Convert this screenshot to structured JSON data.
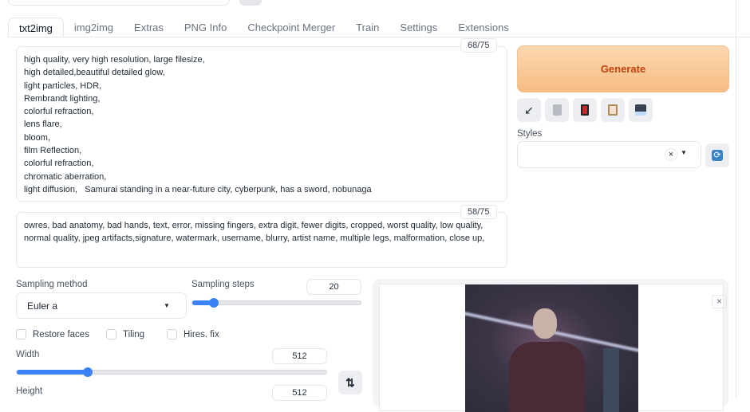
{
  "tabs": [
    "txt2img",
    "img2img",
    "Extras",
    "PNG Info",
    "Checkpoint Merger",
    "Train",
    "Settings",
    "Extensions"
  ],
  "prompt": {
    "text": "high quality, very high resolution, large filesize,\nhigh detailed,beautiful detailed glow,\nlight particles, HDR,\nRembrandt lighting,\ncolorful refraction,\nlens flare,\nbloom,\nfilm Reflection,\ncolorful refraction,\nchromatic aberration,\nlight diffusion,   Samurai standing in a near-future city, cyberpunk, has a sword, nobunaga",
    "token_count": "68/75"
  },
  "negative_prompt": {
    "text": "owres, bad anatomy, bad hands, text, error, missing fingers, extra digit, fewer digits, cropped, worst quality, low quality,\nnormal quality, jpeg artifacts,signature, watermark, username, blurry, artist name, multiple legs, malformation, close up,",
    "token_count": "58/75"
  },
  "generate_label": "Generate",
  "styles": {
    "label": "Styles",
    "value": ""
  },
  "sampling": {
    "method_label": "Sampling method",
    "method": "Euler a",
    "steps_label": "Sampling steps",
    "steps": "20",
    "steps_fraction": 0.13
  },
  "checkboxes": [
    {
      "label": "Restore faces",
      "checked": false
    },
    {
      "label": "Tiling",
      "checked": false
    },
    {
      "label": "Hires. fix",
      "checked": false
    }
  ],
  "width": {
    "label": "Width",
    "value": "512",
    "fraction": 0.23
  },
  "height": {
    "label": "Height",
    "value": "512"
  },
  "colors": {
    "accent": "#3b82f6",
    "generate_text": "#c2410c"
  }
}
